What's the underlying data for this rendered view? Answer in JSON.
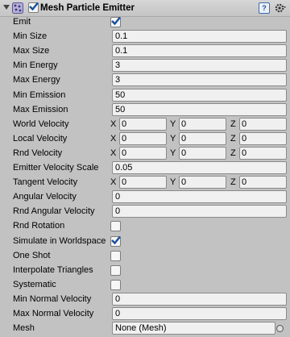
{
  "component": {
    "title": "Mesh Particle Emitter",
    "enabled": true,
    "help_icon_text": "?"
  },
  "rows": [
    {
      "label": "Emit",
      "type": "checkbox",
      "checked": true
    },
    {
      "label": "Min Size",
      "type": "text",
      "value": "0.1"
    },
    {
      "label": "Max Size",
      "type": "text",
      "value": "0.1"
    },
    {
      "label": "Min Energy",
      "type": "text",
      "value": "3"
    },
    {
      "label": "Max Energy",
      "type": "text",
      "value": "3"
    },
    {
      "label": "Min Emission",
      "type": "text",
      "value": "50"
    },
    {
      "label": "Max Emission",
      "type": "text",
      "value": "50"
    },
    {
      "label": "World Velocity",
      "type": "vector",
      "x": "0",
      "y": "0",
      "z": "0"
    },
    {
      "label": "Local Velocity",
      "type": "vector",
      "x": "0",
      "y": "0",
      "z": "0"
    },
    {
      "label": "Rnd Velocity",
      "type": "vector",
      "x": "0",
      "y": "0",
      "z": "0"
    },
    {
      "label": "Emitter Velocity Scale",
      "type": "text",
      "value": "0.05"
    },
    {
      "label": "Tangent Velocity",
      "type": "vector",
      "x": "0",
      "y": "0",
      "z": "0"
    },
    {
      "label": "Angular Velocity",
      "type": "text",
      "value": "0"
    },
    {
      "label": "Rnd Angular Velocity",
      "type": "text",
      "value": "0"
    },
    {
      "label": "Rnd Rotation",
      "type": "checkbox",
      "checked": false
    },
    {
      "label": "Simulate in Worldspace",
      "type": "checkbox",
      "checked": true
    },
    {
      "label": "One Shot",
      "type": "checkbox",
      "checked": false
    },
    {
      "label": "Interpolate Triangles",
      "type": "checkbox",
      "checked": false
    },
    {
      "label": "Systematic",
      "type": "checkbox",
      "checked": false
    },
    {
      "label": "Min Normal Velocity",
      "type": "text",
      "value": "0"
    },
    {
      "label": "Max Normal Velocity",
      "type": "text",
      "value": "0"
    },
    {
      "label": "Mesh",
      "type": "object",
      "value": "None (Mesh)"
    }
  ],
  "axis_labels": {
    "x": "X",
    "y": "Y",
    "z": "Z"
  },
  "colors": {
    "check": "#1a4f9c",
    "field_bg": "#f0f0f0",
    "panel_bg": "#c2c2c2"
  }
}
